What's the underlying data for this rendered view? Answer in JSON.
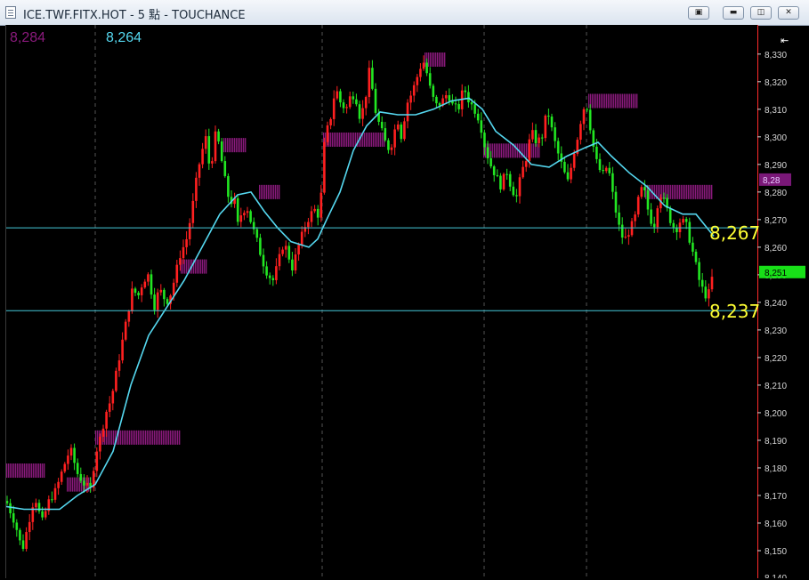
{
  "window": {
    "title": "ICE.TWF.FITX.HOT - 5 點 - TOUCHANCE",
    "buttons": [
      {
        "name": "toolbox-button",
        "glyph": "▣"
      },
      {
        "name": "minimize-button",
        "glyph": "▬"
      },
      {
        "name": "restore-button",
        "glyph": "◫"
      },
      {
        "name": "close-button",
        "glyph": "✕"
      }
    ]
  },
  "header_values": {
    "left": "8,284",
    "right": "8,264"
  },
  "colors": {
    "up": "#ff2020",
    "down": "#22e622",
    "ma": "#55d8f0",
    "profile": "#8a1a7c",
    "hline": "#44c8d8",
    "label": "#ffff33",
    "axis_text": "#d8d8d8",
    "axis_line": "#ff2a2a",
    "last_bg": "#18e018",
    "top_bg": "#7a1878"
  },
  "chart_data": {
    "type": "candlestick",
    "ylim": [
      8140,
      8338
    ],
    "y_ticks": [
      "8,150",
      "8,160",
      "8,170",
      "8,180",
      "8,190",
      "8,200",
      "8,210",
      "8,220",
      "8,230",
      "8,240",
      "8,250",
      "8,260",
      "8,270",
      "8,280",
      "8,290",
      "8,300",
      "8,310",
      "8,320",
      "8,330"
    ],
    "axis_top_marker": "⇤",
    "bottom_tick_partial": "8,140",
    "price_marker_top": "8,28",
    "price_marker_last": "8,251",
    "hlines": [
      {
        "value": 8267,
        "label": "8,267"
      },
      {
        "value": 8237,
        "label": "8,237"
      }
    ],
    "session_dividers": [
      100,
      355,
      537,
      652
    ],
    "path": [
      [
        0,
        8168
      ],
      [
        10,
        8160
      ],
      [
        18,
        8150
      ],
      [
        25,
        8160
      ],
      [
        32,
        8170
      ],
      [
        40,
        8160
      ],
      [
        48,
        8168
      ],
      [
        56,
        8172
      ],
      [
        64,
        8180
      ],
      [
        72,
        8187
      ],
      [
        80,
        8178
      ],
      [
        88,
        8174
      ],
      [
        95,
        8172
      ],
      [
        100,
        8185
      ],
      [
        105,
        8190
      ],
      [
        112,
        8200
      ],
      [
        118,
        8205
      ],
      [
        124,
        8215
      ],
      [
        130,
        8225
      ],
      [
        136,
        8235
      ],
      [
        142,
        8245
      ],
      [
        148,
        8242
      ],
      [
        154,
        8248
      ],
      [
        160,
        8250
      ],
      [
        166,
        8238
      ],
      [
        172,
        8245
      ],
      [
        180,
        8240
      ],
      [
        186,
        8244
      ],
      [
        190,
        8250
      ],
      [
        196,
        8258
      ],
      [
        202,
        8262
      ],
      [
        208,
        8272
      ],
      [
        214,
        8285
      ],
      [
        218,
        8292
      ],
      [
        224,
        8300
      ],
      [
        228,
        8290
      ],
      [
        232,
        8293
      ],
      [
        236,
        8303
      ],
      [
        240,
        8295
      ],
      [
        244,
        8288
      ],
      [
        248,
        8280
      ],
      [
        252,
        8276
      ],
      [
        256,
        8278
      ],
      [
        260,
        8268
      ],
      [
        264,
        8272
      ],
      [
        270,
        8275
      ],
      [
        276,
        8268
      ],
      [
        282,
        8262
      ],
      [
        288,
        8255
      ],
      [
        294,
        8250
      ],
      [
        300,
        8248
      ],
      [
        306,
        8255
      ],
      [
        312,
        8262
      ],
      [
        318,
        8256
      ],
      [
        322,
        8252
      ],
      [
        326,
        8258
      ],
      [
        330,
        8262
      ],
      [
        336,
        8268
      ],
      [
        342,
        8272
      ],
      [
        348,
        8274
      ],
      [
        352,
        8270
      ],
      [
        358,
        8300
      ],
      [
        364,
        8306
      ],
      [
        370,
        8318
      ],
      [
        376,
        8312
      ],
      [
        382,
        8310
      ],
      [
        388,
        8316
      ],
      [
        394,
        8313
      ],
      [
        398,
        8306
      ],
      [
        404,
        8315
      ],
      [
        408,
        8324
      ],
      [
        412,
        8316
      ],
      [
        416,
        8307
      ],
      [
        420,
        8304
      ],
      [
        424,
        8300
      ],
      [
        428,
        8296
      ],
      [
        432,
        8296
      ],
      [
        436,
        8302
      ],
      [
        440,
        8306
      ],
      [
        444,
        8300
      ],
      [
        450,
        8312
      ],
      [
        456,
        8316
      ],
      [
        462,
        8322
      ],
      [
        468,
        8328
      ],
      [
        472,
        8324
      ],
      [
        478,
        8315
      ],
      [
        484,
        8311
      ],
      [
        490,
        8313
      ],
      [
        496,
        8316
      ],
      [
        502,
        8311
      ],
      [
        508,
        8310
      ],
      [
        514,
        8318
      ],
      [
        520,
        8313
      ],
      [
        526,
        8310
      ],
      [
        532,
        8306
      ],
      [
        538,
        8296
      ],
      [
        544,
        8290
      ],
      [
        550,
        8286
      ],
      [
        556,
        8282
      ],
      [
        562,
        8288
      ],
      [
        568,
        8281
      ],
      [
        574,
        8278
      ],
      [
        578,
        8286
      ],
      [
        584,
        8292
      ],
      [
        590,
        8302
      ],
      [
        596,
        8298
      ],
      [
        602,
        8300
      ],
      [
        608,
        8310
      ],
      [
        612,
        8304
      ],
      [
        618,
        8296
      ],
      [
        624,
        8290
      ],
      [
        628,
        8286
      ],
      [
        632,
        8283
      ],
      [
        636,
        8292
      ],
      [
        642,
        8300
      ],
      [
        648,
        8310
      ],
      [
        652,
        8312
      ],
      [
        656,
        8304
      ],
      [
        660,
        8296
      ],
      [
        664,
        8290
      ],
      [
        670,
        8286
      ],
      [
        676,
        8290
      ],
      [
        682,
        8278
      ],
      [
        688,
        8268
      ],
      [
        694,
        8262
      ],
      [
        700,
        8266
      ],
      [
        706,
        8270
      ],
      [
        712,
        8280
      ],
      [
        716,
        8282
      ],
      [
        720,
        8275
      ],
      [
        724,
        8270
      ],
      [
        728,
        8268
      ],
      [
        734,
        8280
      ],
      [
        740,
        8276
      ],
      [
        746,
        8270
      ],
      [
        752,
        8266
      ],
      [
        758,
        8270
      ],
      [
        764,
        8268
      ],
      [
        770,
        8260
      ],
      [
        776,
        8252
      ],
      [
        780,
        8246
      ],
      [
        784,
        8244
      ],
      [
        788,
        8241
      ],
      [
        792,
        8248
      ],
      [
        796,
        8251
      ]
    ],
    "ma_line": [
      [
        0,
        8166
      ],
      [
        20,
        8165
      ],
      [
        40,
        8165
      ],
      [
        60,
        8165
      ],
      [
        80,
        8170
      ],
      [
        100,
        8174
      ],
      [
        120,
        8186
      ],
      [
        140,
        8210
      ],
      [
        160,
        8228
      ],
      [
        180,
        8238
      ],
      [
        200,
        8248
      ],
      [
        220,
        8260
      ],
      [
        240,
        8272
      ],
      [
        260,
        8279
      ],
      [
        275,
        8280
      ],
      [
        290,
        8273
      ],
      [
        305,
        8267
      ],
      [
        320,
        8262
      ],
      [
        340,
        8260
      ],
      [
        350,
        8263
      ],
      [
        360,
        8270
      ],
      [
        375,
        8280
      ],
      [
        390,
        8295
      ],
      [
        405,
        8304
      ],
      [
        420,
        8309
      ],
      [
        440,
        8308
      ],
      [
        460,
        8308
      ],
      [
        480,
        8310
      ],
      [
        500,
        8313
      ],
      [
        520,
        8314
      ],
      [
        535,
        8310
      ],
      [
        550,
        8302
      ],
      [
        570,
        8297
      ],
      [
        590,
        8290
      ],
      [
        610,
        8289
      ],
      [
        630,
        8293
      ],
      [
        650,
        8296
      ],
      [
        665,
        8298
      ],
      [
        680,
        8293
      ],
      [
        700,
        8287
      ],
      [
        720,
        8282
      ],
      [
        740,
        8275
      ],
      [
        760,
        8272
      ],
      [
        775,
        8272
      ],
      [
        785,
        8268
      ],
      [
        795,
        8264
      ]
    ],
    "volume_profile": [
      {
        "x0": 0,
        "x1": 44,
        "y": 8179
      },
      {
        "x0": 68,
        "x1": 96,
        "y": 8174
      },
      {
        "x0": 100,
        "x1": 196,
        "y": 8191
      },
      {
        "x0": 196,
        "x1": 226,
        "y": 8253
      },
      {
        "x0": 244,
        "x1": 270,
        "y": 8297
      },
      {
        "x0": 284,
        "x1": 308,
        "y": 8280
      },
      {
        "x0": 356,
        "x1": 426,
        "y": 8299
      },
      {
        "x0": 470,
        "x1": 494,
        "y": 8328
      },
      {
        "x0": 536,
        "x1": 600,
        "y": 8295
      },
      {
        "x0": 654,
        "x1": 710,
        "y": 8313
      },
      {
        "x0": 718,
        "x1": 794,
        "y": 8280
      }
    ]
  }
}
